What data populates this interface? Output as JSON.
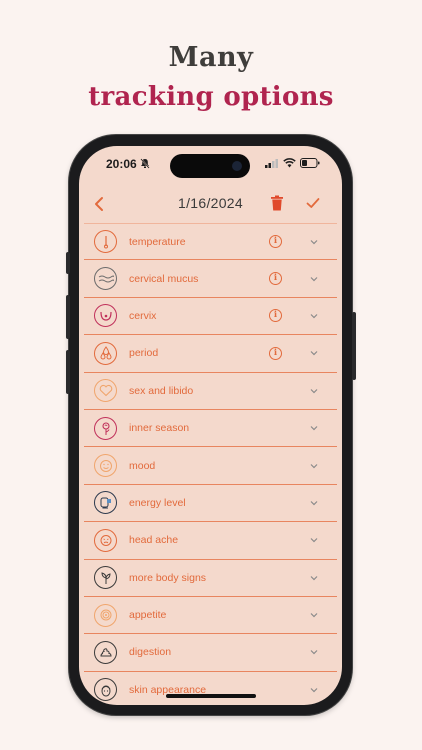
{
  "headline": {
    "line1": "Many",
    "line2": "tracking options"
  },
  "status_bar": {
    "time": "20:06"
  },
  "header": {
    "date": "1/16/2024"
  },
  "rows": [
    {
      "label": "temperature",
      "icon": "thermometer-icon",
      "color": "#e26a3c",
      "info": true
    },
    {
      "label": "cervical mucus",
      "icon": "mucus-waves-icon",
      "color": "#6b6b6b",
      "info": true
    },
    {
      "label": "cervix",
      "icon": "cervix-icon",
      "color": "#c0305a",
      "info": true
    },
    {
      "label": "period",
      "icon": "drops-icon",
      "color": "#e26a3c",
      "info": true
    },
    {
      "label": "sex and libido",
      "icon": "heart-icon",
      "color": "#f0a56c",
      "info": false
    },
    {
      "label": "inner season",
      "icon": "rose-icon",
      "color": "#c0305a",
      "info": false
    },
    {
      "label": "mood",
      "icon": "mood-face-icon",
      "color": "#f0a56c",
      "info": false
    },
    {
      "label": "energy level",
      "icon": "energy-face-icon",
      "color": "#2d3a4e",
      "info": false
    },
    {
      "label": "head ache",
      "icon": "headache-face-icon",
      "color": "#e26a3c",
      "info": false
    },
    {
      "label": "more body signs",
      "icon": "leaf-body-icon",
      "color": "#3a3a3a",
      "info": false
    },
    {
      "label": "appetite",
      "icon": "food-spiral-icon",
      "color": "#f0a56c",
      "info": false
    },
    {
      "label": "digestion",
      "icon": "digestion-icon",
      "color": "#3a3a3a",
      "info": false
    },
    {
      "label": "skin appearance",
      "icon": "skin-face-icon",
      "color": "#3a3a3a",
      "info": false
    }
  ]
}
